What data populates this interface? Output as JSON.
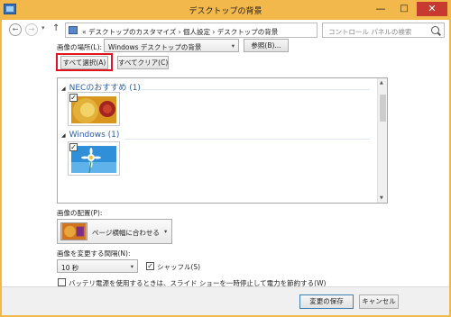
{
  "window": {
    "title": "デスクトップの背景",
    "minimize_glyph": "—",
    "maximize_glyph": "□",
    "close_glyph": "✕"
  },
  "nav": {
    "back_glyph": "←",
    "forward_glyph": "→",
    "dropdown_glyph": "▾",
    "up_glyph": "↑",
    "breadcrumb": "«  デスクトップのカスタマイズ  ›  個人設定  ›  デスクトップの背景",
    "breadcrumb_dropdown_glyph": "▾",
    "refresh_glyph": "↻",
    "search_placeholder": "コントロール パネルの検索"
  },
  "location": {
    "label": "画像の場所(L):",
    "value": "Windows デスクトップの背景",
    "arrow": "▾",
    "browse_label": "参照(B)..."
  },
  "selection": {
    "select_all_label": "すべて選択(A)",
    "clear_all_label": "すべてクリア(C)"
  },
  "gallery": {
    "groups": [
      {
        "title": "NECのおすすめ (1)",
        "checked": true
      },
      {
        "title": "Windows (1)",
        "checked": true
      }
    ],
    "expand_glyph": "◢",
    "check_glyph": "✓",
    "scroll_up_glyph": "▲",
    "scroll_down_glyph": "▼"
  },
  "position": {
    "label": "画像の配置(P):",
    "value": "ページ横幅に合わせる",
    "arrow": "▾"
  },
  "interval": {
    "label": "画像を変更する間隔(N):",
    "value": "10 秒",
    "arrow": "▾",
    "shuffle_label": "シャッフル(S)",
    "shuffle_checked": true,
    "battery_label": "バッテリ電源を使用するときは、スライド ショーを一時停止して電力を節約する(W)",
    "battery_checked": false
  },
  "footer": {
    "save_label": "変更の保存",
    "cancel_label": "キャンセル"
  },
  "colors": {
    "title_bar": "#f2b84b",
    "close_button": "#c73a2f",
    "highlight": "#e0141e",
    "group_header": "#2b5ea7"
  }
}
